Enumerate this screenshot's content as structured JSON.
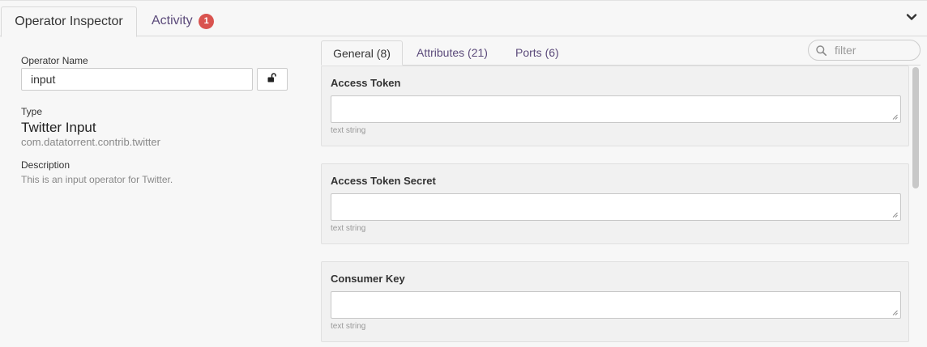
{
  "main_tabs": [
    {
      "label": "Operator Inspector"
    },
    {
      "label": "Activity",
      "badge": "1"
    }
  ],
  "operator": {
    "name_label": "Operator Name",
    "name_value": "input",
    "type_label": "Type",
    "type_name": "Twitter Input",
    "type_class": "com.datatorrent.contrib.twitter",
    "description_label": "Description",
    "description": "This is an input operator for Twitter."
  },
  "sub_tabs": [
    {
      "label": "General (8)"
    },
    {
      "label": "Attributes (21)"
    },
    {
      "label": "Ports (6)"
    }
  ],
  "filter": {
    "placeholder": "filter"
  },
  "properties": [
    {
      "title": "Access Token",
      "value": "",
      "hint": "text string"
    },
    {
      "title": "Access Token Secret",
      "value": "",
      "hint": "text string"
    },
    {
      "title": "Consumer Key",
      "value": "",
      "hint": "text string"
    }
  ],
  "icons": {
    "lock": "unlock-icon",
    "collapse": "chevron-down-icon",
    "search": "search-icon"
  },
  "colors": {
    "accent": "#5b4a7a",
    "badge": "#d9534f"
  }
}
